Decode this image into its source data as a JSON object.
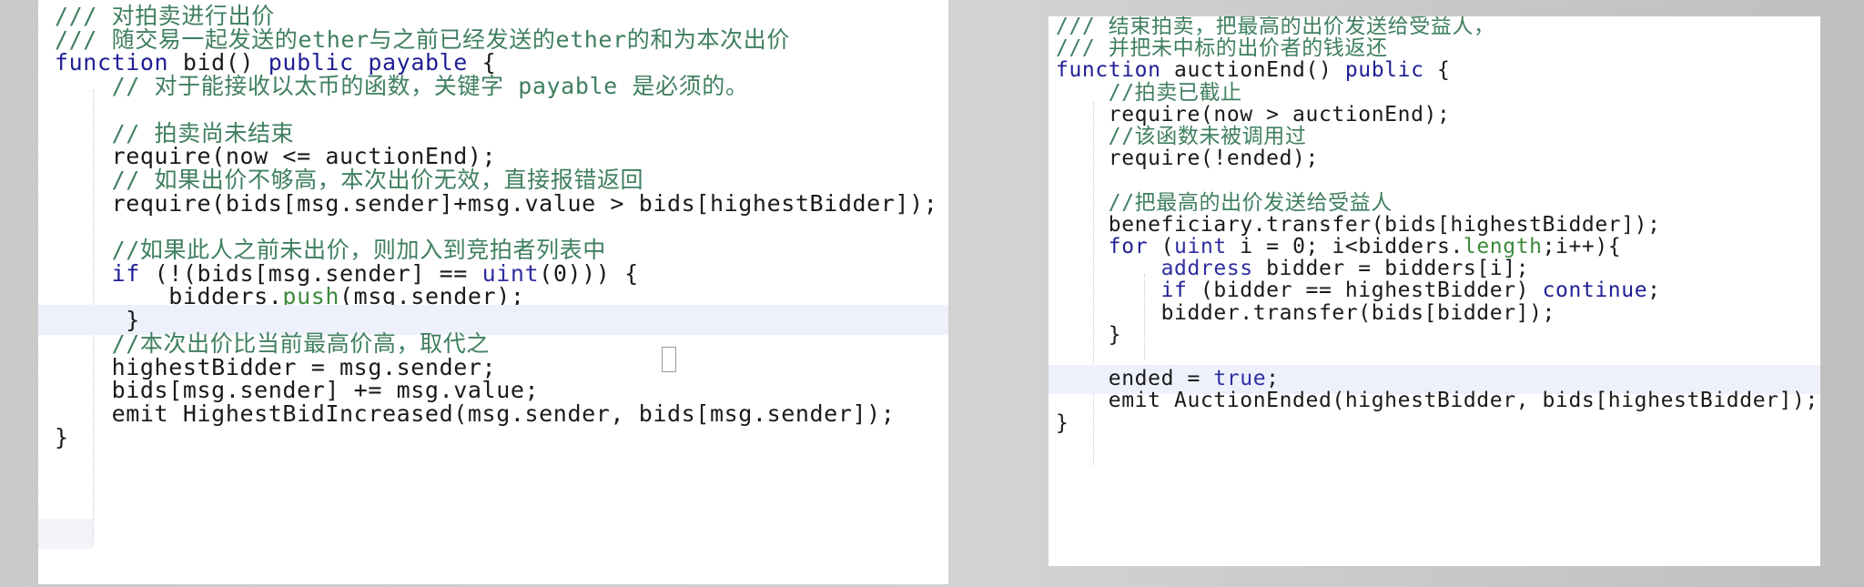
{
  "left_code": {
    "lines": [
      [
        {
          "t": "/// 对拍卖进行出价",
          "k": "comment"
        }
      ],
      [
        {
          "t": "/// 随交易一起发送的ether与之前已经发送的ether的和为本次出价",
          "k": "comment"
        }
      ],
      [
        {
          "t": "function",
          "k": "keyword"
        },
        {
          "t": " bid() ",
          "k": "plain"
        },
        {
          "t": "public",
          "k": "keyword"
        },
        {
          "t": " ",
          "k": "plain"
        },
        {
          "t": "payable",
          "k": "keyword"
        },
        {
          "t": " {",
          "k": "plain"
        }
      ],
      [
        {
          "t": "    // 对于能接收以太币的函数，关键字 payable 是必须的。",
          "k": "comment"
        }
      ],
      [
        {
          "t": "",
          "k": "plain"
        }
      ],
      [
        {
          "t": "    // 拍卖尚未结束",
          "k": "comment"
        }
      ],
      [
        {
          "t": "    require(now <= auctionEnd);",
          "k": "plain"
        }
      ],
      [
        {
          "t": "    // 如果出价不够高，本次出价无效，直接报错返回",
          "k": "comment"
        }
      ],
      [
        {
          "t": "    require(bids[msg.sender]+msg.value > bids[highestBidder]);",
          "k": "plain"
        }
      ],
      [
        {
          "t": "",
          "k": "plain"
        }
      ],
      [
        {
          "t": "    //如果此人之前未出价，则加入到竞拍者列表中",
          "k": "comment"
        }
      ],
      [
        {
          "t": "    ",
          "k": "plain"
        },
        {
          "t": "if",
          "k": "keyword"
        },
        {
          "t": " (!(bids[msg.sender] == ",
          "k": "plain"
        },
        {
          "t": "uint",
          "k": "keyword2"
        },
        {
          "t": "(0))) {",
          "k": "plain"
        }
      ],
      [
        {
          "t": "        bidders.",
          "k": "plain"
        },
        {
          "t": "push",
          "k": "builtin"
        },
        {
          "t": "(msg.sender);",
          "k": "plain"
        }
      ],
      [
        {
          "t": "     }",
          "k": "plain"
        }
      ],
      [
        {
          "t": "    //本次出价比当前最高价高，取代之",
          "k": "comment"
        }
      ],
      [
        {
          "t": "    highestBidder = msg.sender;",
          "k": "plain"
        }
      ],
      [
        {
          "t": "    bids[msg.sender] += msg.value;",
          "k": "plain"
        }
      ],
      [
        {
          "t": "    emit HighestBidIncreased(msg.sender, bids[msg.sender]);",
          "k": "plain"
        }
      ],
      [
        {
          "t": "}",
          "k": "plain"
        }
      ]
    ]
  },
  "right_code": {
    "lines": [
      [
        {
          "t": "/// 结束拍卖，把最高的出价发送给受益人，",
          "k": "comment"
        }
      ],
      [
        {
          "t": "/// 并把未中标的出价者的钱返还",
          "k": "comment"
        }
      ],
      [
        {
          "t": "function",
          "k": "keyword"
        },
        {
          "t": " auctionEnd() ",
          "k": "plain"
        },
        {
          "t": "public",
          "k": "keyword"
        },
        {
          "t": " {",
          "k": "plain"
        }
      ],
      [
        {
          "t": "    //拍卖已截止",
          "k": "comment"
        }
      ],
      [
        {
          "t": "    require(now > auctionEnd);",
          "k": "plain"
        }
      ],
      [
        {
          "t": "    //该函数未被调用过",
          "k": "comment"
        }
      ],
      [
        {
          "t": "    require(!ended);",
          "k": "plain"
        }
      ],
      [
        {
          "t": "",
          "k": "plain"
        }
      ],
      [
        {
          "t": "    //把最高的出价发送给受益人",
          "k": "comment"
        }
      ],
      [
        {
          "t": "    beneficiary.transfer(bids[highestBidder]);",
          "k": "plain"
        }
      ],
      [
        {
          "t": "    ",
          "k": "plain"
        },
        {
          "t": "for",
          "k": "keyword"
        },
        {
          "t": " (",
          "k": "plain"
        },
        {
          "t": "uint",
          "k": "keyword2"
        },
        {
          "t": " i = 0; i<bidders.",
          "k": "plain"
        },
        {
          "t": "length",
          "k": "builtin"
        },
        {
          "t": ";i++){",
          "k": "plain"
        }
      ],
      [
        {
          "t": "        ",
          "k": "plain"
        },
        {
          "t": "address",
          "k": "keyword2"
        },
        {
          "t": " bidder = bidders[i];",
          "k": "plain"
        }
      ],
      [
        {
          "t": "        ",
          "k": "plain"
        },
        {
          "t": "if",
          "k": "keyword"
        },
        {
          "t": " (bidder == highestBidder) ",
          "k": "plain"
        },
        {
          "t": "continue",
          "k": "keyword"
        },
        {
          "t": ";",
          "k": "plain"
        }
      ],
      [
        {
          "t": "        bidder.transfer(bids[bidder]);",
          "k": "plain"
        }
      ],
      [
        {
          "t": "    }",
          "k": "plain"
        }
      ],
      [
        {
          "t": "",
          "k": "plain"
        }
      ],
      [
        {
          "t": "    ended = ",
          "k": "plain"
        },
        {
          "t": "true",
          "k": "keyword2"
        },
        {
          "t": ";",
          "k": "plain"
        }
      ],
      [
        {
          "t": "    emit AuctionEnded(highestBidder, bids[highestBidder]);",
          "k": "plain"
        }
      ],
      [
        {
          "t": "}",
          "k": "plain"
        }
      ]
    ]
  },
  "colors": {
    "comment": "#3f7f5f",
    "keyword": "#1f1f96",
    "keyword2": "#2e2ea2",
    "builtin": "#3b8a3b",
    "plain": "#1a1a1a",
    "current_line_highlight": "#eef1fb"
  }
}
